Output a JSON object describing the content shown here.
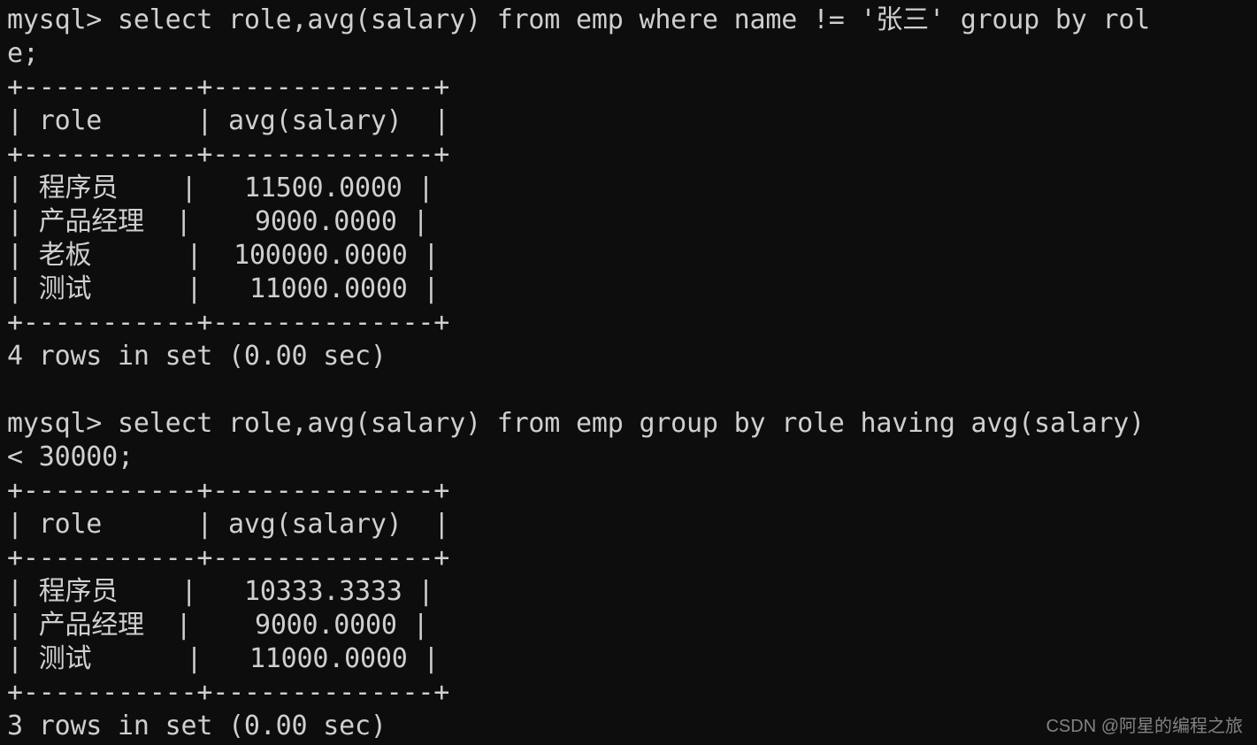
{
  "terminal": {
    "prompt": "mysql> ",
    "background_color": "#0d0d0d",
    "text_color": "#cfcfcf",
    "lines": [
      "mysql> select role,avg(salary) from emp where name != '张三' group by rol",
      "e;",
      "+-----------+--------------+",
      "| role      | avg(salary)  |",
      "+-----------+--------------+",
      "| 程序员    |   11500.0000 |",
      "| 产品经理  |    9000.0000 |",
      "| 老板      |  100000.0000 |",
      "| 测试      |   11000.0000 |",
      "+-----------+--------------+",
      "4 rows in set (0.00 sec)",
      "",
      "mysql> select role,avg(salary) from emp group by role having avg(salary)",
      "< 30000;",
      "+-----------+--------------+",
      "| role      | avg(salary)  |",
      "+-----------+--------------+",
      "| 程序员    |   10333.3333 |",
      "| 产品经理  |    9000.0000 |",
      "| 测试      |   11000.0000 |",
      "+-----------+--------------+",
      "3 rows in set (0.00 sec)"
    ],
    "queries": [
      {
        "sql": "select role,avg(salary) from emp where name != '张三' group by role;",
        "columns": [
          "role",
          "avg(salary)"
        ],
        "rows": [
          [
            "程序员",
            "11500.0000"
          ],
          [
            "产品经理",
            "9000.0000"
          ],
          [
            "老板",
            "100000.0000"
          ],
          [
            "测试",
            "11000.0000"
          ]
        ],
        "result_status": "4 rows in set (0.00 sec)"
      },
      {
        "sql": "select role,avg(salary) from emp group by role having avg(salary) < 30000;",
        "columns": [
          "role",
          "avg(salary)"
        ],
        "rows": [
          [
            "程序员",
            "10333.3333"
          ],
          [
            "产品经理",
            "9000.0000"
          ],
          [
            "测试",
            "11000.0000"
          ]
        ],
        "result_status": "3 rows in set (0.00 sec)"
      }
    ]
  },
  "watermark": {
    "text": "CSDN @阿星的编程之旅"
  }
}
